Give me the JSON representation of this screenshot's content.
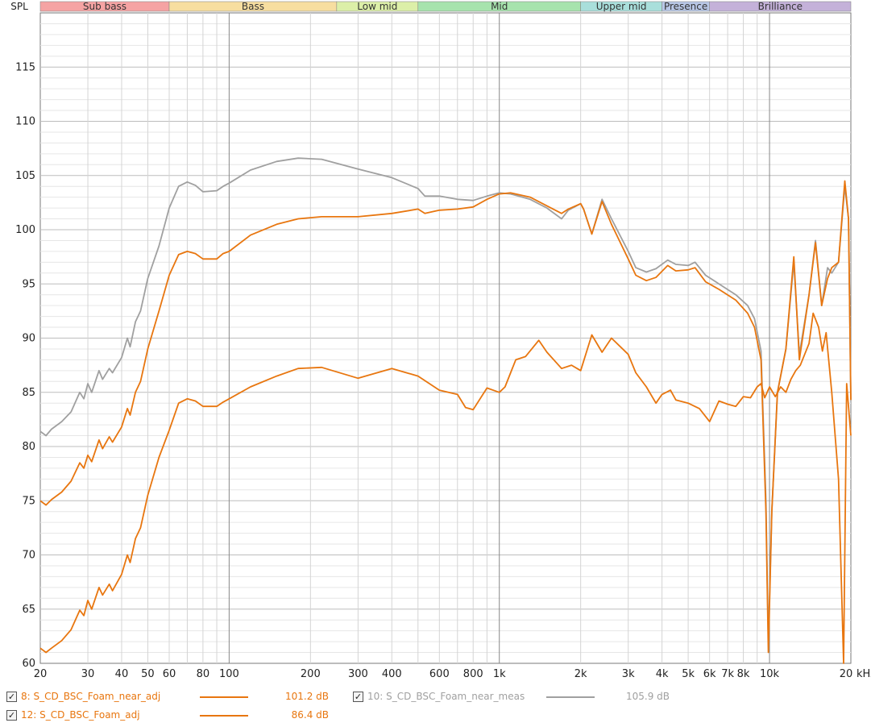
{
  "chart_data": {
    "type": "line",
    "ylabel": "SPL",
    "x_unit_label": "kHz",
    "x_scale": "log",
    "xlim": [
      20,
      20000
    ],
    "ylim": [
      60,
      120
    ],
    "grid": true,
    "legend_position": "bottom",
    "y_ticks": [
      60,
      65,
      70,
      75,
      80,
      85,
      90,
      95,
      100,
      105,
      110,
      115
    ],
    "x_ticks": [
      {
        "v": 20,
        "label": "20"
      },
      {
        "v": 30,
        "label": "30"
      },
      {
        "v": 40,
        "label": "40"
      },
      {
        "v": 50,
        "label": "50"
      },
      {
        "v": 60,
        "label": "60"
      },
      {
        "v": 80,
        "label": "80"
      },
      {
        "v": 100,
        "label": "100"
      },
      {
        "v": 200,
        "label": "200"
      },
      {
        "v": 300,
        "label": "300"
      },
      {
        "v": 400,
        "label": "400"
      },
      {
        "v": 600,
        "label": "600"
      },
      {
        "v": 800,
        "label": "800"
      },
      {
        "v": 1000,
        "label": "1k"
      },
      {
        "v": 2000,
        "label": "2k"
      },
      {
        "v": 3000,
        "label": "3k"
      },
      {
        "v": 4000,
        "label": "4k"
      },
      {
        "v": 5000,
        "label": "5k"
      },
      {
        "v": 6000,
        "label": "6k"
      },
      {
        "v": 7000,
        "label": "7k"
      },
      {
        "v": 8000,
        "label": "8k"
      },
      {
        "v": 10000,
        "label": "10k"
      },
      {
        "v": 20000,
        "label": "20"
      }
    ],
    "bands": [
      {
        "name": "Sub bass",
        "from": 20,
        "to": 60,
        "color": "#f5a3a3"
      },
      {
        "name": "Bass",
        "from": 60,
        "to": 250,
        "color": "#f7dea0"
      },
      {
        "name": "Low mid",
        "from": 250,
        "to": 500,
        "color": "#dcefa8"
      },
      {
        "name": "Mid",
        "from": 500,
        "to": 2000,
        "color": "#a7e3ad"
      },
      {
        "name": "Upper mid",
        "from": 2000,
        "to": 4000,
        "color": "#a9dfdb"
      },
      {
        "name": "Presence",
        "from": 4000,
        "to": 6000,
        "color": "#b8c7e6"
      },
      {
        "name": "Brilliance",
        "from": 6000,
        "to": 20000,
        "color": "#c4b1d9"
      }
    ],
    "series": [
      {
        "name": "10: S_CD_BSC_Foam_near_meas",
        "checkbox_label": "10:",
        "value_label": "105.9 dB",
        "color": "#a0a0a0",
        "points": [
          [
            20,
            81.4
          ],
          [
            21,
            81.0
          ],
          [
            22,
            81.6
          ],
          [
            24,
            82.3
          ],
          [
            26,
            83.2
          ],
          [
            28,
            85.0
          ],
          [
            29,
            84.4
          ],
          [
            30,
            85.8
          ],
          [
            31,
            85.0
          ],
          [
            33,
            87.0
          ],
          [
            34,
            86.2
          ],
          [
            36,
            87.2
          ],
          [
            37,
            86.8
          ],
          [
            40,
            88.2
          ],
          [
            42,
            90.0
          ],
          [
            43,
            89.2
          ],
          [
            45,
            91.5
          ],
          [
            47,
            92.5
          ],
          [
            50,
            95.5
          ],
          [
            55,
            98.5
          ],
          [
            60,
            102.0
          ],
          [
            65,
            104.0
          ],
          [
            70,
            104.4
          ],
          [
            75,
            104.1
          ],
          [
            80,
            103.5
          ],
          [
            90,
            103.6
          ],
          [
            95,
            104.0
          ],
          [
            100,
            104.3
          ],
          [
            120,
            105.5
          ],
          [
            150,
            106.3
          ],
          [
            180,
            106.6
          ],
          [
            220,
            106.5
          ],
          [
            300,
            105.6
          ],
          [
            400,
            104.8
          ],
          [
            500,
            103.8
          ],
          [
            530,
            103.1
          ],
          [
            600,
            103.1
          ],
          [
            700,
            102.8
          ],
          [
            800,
            102.7
          ],
          [
            900,
            103.1
          ],
          [
            1000,
            103.4
          ],
          [
            1100,
            103.3
          ],
          [
            1300,
            102.8
          ],
          [
            1500,
            102.0
          ],
          [
            1700,
            101.0
          ],
          [
            1800,
            101.8
          ],
          [
            2000,
            102.4
          ],
          [
            2050,
            101.9
          ],
          [
            2200,
            99.6
          ],
          [
            2400,
            102.8
          ],
          [
            2600,
            101.0
          ],
          [
            3000,
            98.0
          ],
          [
            3200,
            96.5
          ],
          [
            3500,
            96.1
          ],
          [
            3800,
            96.4
          ],
          [
            4200,
            97.2
          ],
          [
            4500,
            96.8
          ],
          [
            5000,
            96.7
          ],
          [
            5300,
            97.0
          ],
          [
            5800,
            95.8
          ],
          [
            6500,
            95.0
          ],
          [
            7500,
            94.0
          ],
          [
            8300,
            93.0
          ],
          [
            8800,
            91.8
          ],
          [
            9300,
            88.8
          ],
          [
            9700,
            75.0
          ],
          [
            9900,
            62.0
          ],
          [
            10200,
            74.0
          ],
          [
            10700,
            85.0
          ],
          [
            11500,
            89.0
          ],
          [
            12300,
            97.0
          ],
          [
            12900,
            88.5
          ],
          [
            14000,
            94.0
          ],
          [
            14800,
            99.0
          ],
          [
            15600,
            93.0
          ],
          [
            16400,
            96.5
          ],
          [
            17000,
            96.0
          ],
          [
            18000,
            97.0
          ],
          [
            19000,
            104.0
          ],
          [
            19600,
            101.0
          ],
          [
            20000,
            84.3
          ]
        ]
      },
      {
        "name": "8: S_CD_BSC_Foam_near_adj",
        "checkbox_label": "8:",
        "value_label": "101.2 dB",
        "color": "#e8760f",
        "points": [
          [
            20,
            75.0
          ],
          [
            21,
            74.6
          ],
          [
            22,
            75.1
          ],
          [
            24,
            75.8
          ],
          [
            26,
            76.8
          ],
          [
            28,
            78.5
          ],
          [
            29,
            78.0
          ],
          [
            30,
            79.2
          ],
          [
            31,
            78.6
          ],
          [
            33,
            80.6
          ],
          [
            34,
            79.8
          ],
          [
            36,
            80.9
          ],
          [
            37,
            80.4
          ],
          [
            40,
            81.8
          ],
          [
            42,
            83.5
          ],
          [
            43,
            82.9
          ],
          [
            45,
            85.0
          ],
          [
            47,
            86.0
          ],
          [
            50,
            89.0
          ],
          [
            55,
            92.5
          ],
          [
            60,
            95.8
          ],
          [
            65,
            97.7
          ],
          [
            70,
            98.0
          ],
          [
            75,
            97.8
          ],
          [
            80,
            97.3
          ],
          [
            90,
            97.3
          ],
          [
            95,
            97.8
          ],
          [
            100,
            98.0
          ],
          [
            120,
            99.5
          ],
          [
            150,
            100.5
          ],
          [
            180,
            101.0
          ],
          [
            220,
            101.2
          ],
          [
            300,
            101.2
          ],
          [
            400,
            101.5
          ],
          [
            500,
            101.9
          ],
          [
            530,
            101.5
          ],
          [
            600,
            101.8
          ],
          [
            700,
            101.9
          ],
          [
            800,
            102.1
          ],
          [
            900,
            102.8
          ],
          [
            1000,
            103.3
          ],
          [
            1100,
            103.4
          ],
          [
            1300,
            103.0
          ],
          [
            1500,
            102.2
          ],
          [
            1700,
            101.5
          ],
          [
            1800,
            101.9
          ],
          [
            2000,
            102.4
          ],
          [
            2050,
            101.9
          ],
          [
            2200,
            99.6
          ],
          [
            2400,
            102.6
          ],
          [
            2600,
            100.5
          ],
          [
            3000,
            97.3
          ],
          [
            3200,
            95.8
          ],
          [
            3500,
            95.3
          ],
          [
            3800,
            95.6
          ],
          [
            4200,
            96.7
          ],
          [
            4500,
            96.2
          ],
          [
            5000,
            96.3
          ],
          [
            5300,
            96.5
          ],
          [
            5800,
            95.2
          ],
          [
            6500,
            94.5
          ],
          [
            7500,
            93.5
          ],
          [
            8300,
            92.3
          ],
          [
            8800,
            91.0
          ],
          [
            9300,
            88.0
          ],
          [
            9700,
            74.0
          ],
          [
            9900,
            61.0
          ],
          [
            10200,
            74.0
          ],
          [
            10700,
            85.0
          ],
          [
            11500,
            89.0
          ],
          [
            12300,
            97.5
          ],
          [
            12900,
            88.0
          ],
          [
            14000,
            94.0
          ],
          [
            14800,
            98.8
          ],
          [
            15600,
            93.0
          ],
          [
            16400,
            95.5
          ],
          [
            17000,
            96.5
          ],
          [
            18000,
            97.0
          ],
          [
            19000,
            104.5
          ],
          [
            19600,
            101.0
          ],
          [
            20000,
            84.3
          ]
        ]
      },
      {
        "name": "12: S_CD_BSC_Foam_adj",
        "checkbox_label": "12:",
        "value_label": "86.4 dB",
        "color": "#e8760f",
        "points": [
          [
            20,
            61.4
          ],
          [
            21,
            61.0
          ],
          [
            22,
            61.4
          ],
          [
            24,
            62.1
          ],
          [
            26,
            63.1
          ],
          [
            28,
            64.9
          ],
          [
            29,
            64.4
          ],
          [
            30,
            65.8
          ],
          [
            31,
            65.0
          ],
          [
            33,
            67.0
          ],
          [
            34,
            66.3
          ],
          [
            36,
            67.3
          ],
          [
            37,
            66.7
          ],
          [
            40,
            68.2
          ],
          [
            42,
            70.0
          ],
          [
            43,
            69.3
          ],
          [
            45,
            71.5
          ],
          [
            47,
            72.5
          ],
          [
            50,
            75.5
          ],
          [
            55,
            79.0
          ],
          [
            60,
            81.5
          ],
          [
            65,
            84.0
          ],
          [
            70,
            84.4
          ],
          [
            75,
            84.2
          ],
          [
            80,
            83.7
          ],
          [
            90,
            83.7
          ],
          [
            95,
            84.1
          ],
          [
            100,
            84.4
          ],
          [
            120,
            85.5
          ],
          [
            150,
            86.5
          ],
          [
            180,
            87.2
          ],
          [
            220,
            87.3
          ],
          [
            300,
            86.3
          ],
          [
            400,
            87.2
          ],
          [
            500,
            86.5
          ],
          [
            600,
            85.2
          ],
          [
            700,
            84.8
          ],
          [
            750,
            83.6
          ],
          [
            800,
            83.4
          ],
          [
            900,
            85.4
          ],
          [
            1000,
            85.0
          ],
          [
            1050,
            85.5
          ],
          [
            1150,
            88.0
          ],
          [
            1250,
            88.3
          ],
          [
            1400,
            89.8
          ],
          [
            1500,
            88.7
          ],
          [
            1700,
            87.2
          ],
          [
            1850,
            87.5
          ],
          [
            2000,
            87.0
          ],
          [
            2200,
            90.3
          ],
          [
            2400,
            88.7
          ],
          [
            2600,
            90.0
          ],
          [
            3000,
            88.5
          ],
          [
            3200,
            86.8
          ],
          [
            3500,
            85.5
          ],
          [
            3800,
            84.0
          ],
          [
            4000,
            84.8
          ],
          [
            4300,
            85.2
          ],
          [
            4500,
            84.3
          ],
          [
            5000,
            84.0
          ],
          [
            5500,
            83.5
          ],
          [
            6000,
            82.3
          ],
          [
            6500,
            84.2
          ],
          [
            7000,
            83.9
          ],
          [
            7500,
            83.7
          ],
          [
            8000,
            84.6
          ],
          [
            8500,
            84.5
          ],
          [
            9000,
            85.5
          ],
          [
            9300,
            85.8
          ],
          [
            9600,
            84.5
          ],
          [
            10000,
            85.5
          ],
          [
            10500,
            84.6
          ],
          [
            11000,
            85.5
          ],
          [
            11500,
            85.0
          ],
          [
            12000,
            86.2
          ],
          [
            12500,
            87.0
          ],
          [
            13000,
            87.5
          ],
          [
            14000,
            89.5
          ],
          [
            14500,
            92.3
          ],
          [
            15200,
            91.0
          ],
          [
            15700,
            88.8
          ],
          [
            16200,
            90.5
          ],
          [
            17000,
            85.0
          ],
          [
            18000,
            77.0
          ],
          [
            18800,
            60.0
          ],
          [
            19300,
            85.8
          ],
          [
            20000,
            81.0
          ]
        ]
      }
    ]
  },
  "legend": [
    {
      "checked": "✓",
      "name": "8: S_CD_BSC_Foam_near_adj",
      "value": "101.2 dB",
      "color": "#e8760f"
    },
    {
      "checked": "✓",
      "name": "12: S_CD_BSC_Foam_adj",
      "value": "86.4 dB",
      "color": "#e8760f"
    },
    {
      "checked": "✓",
      "name": "10: S_CD_BSC_Foam_near_meas",
      "value": "105.9 dB",
      "color": "#a0a0a0"
    }
  ]
}
